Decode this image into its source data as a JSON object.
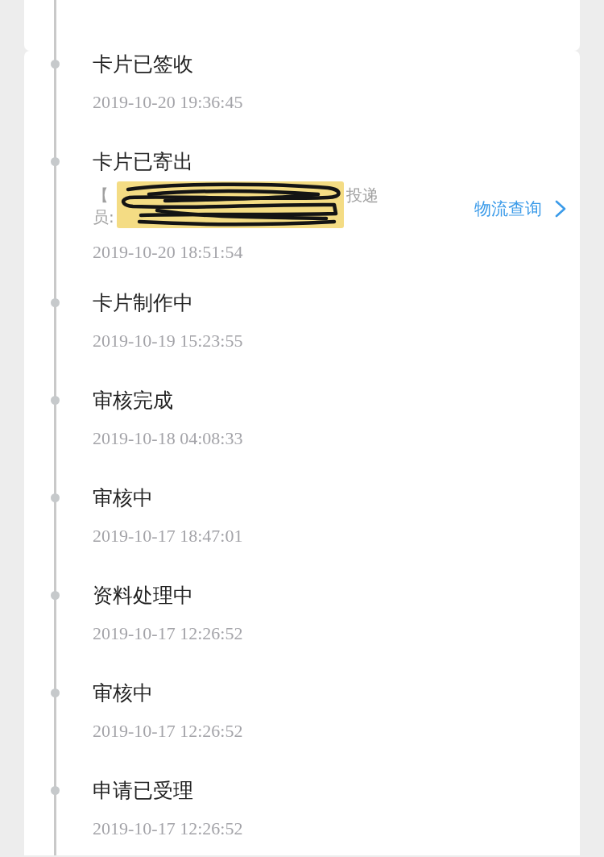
{
  "timeline": [
    {
      "title": "卡片已签收",
      "time": "2019-10-20 19:36:45"
    },
    {
      "title": "卡片已寄出",
      "detail": {
        "redacted": true,
        "lines": [
          {
            "fragments": [
              "【",
              "投递"
            ]
          },
          {
            "fragments": [
              "员:"
            ]
          }
        ]
      },
      "action": {
        "label": "物流查询"
      },
      "time": "2019-10-20 18:51:54"
    },
    {
      "title": "卡片制作中",
      "time": "2019-10-19 15:23:55"
    },
    {
      "title": "审核完成",
      "time": "2019-10-18 04:08:33"
    },
    {
      "title": "审核中",
      "time": "2019-10-17 18:47:01"
    },
    {
      "title": "资料处理中",
      "time": "2019-10-17 12:26:52"
    },
    {
      "title": "审核中",
      "time": "2019-10-17 12:26:52"
    },
    {
      "title": "申请已受理",
      "time": "2019-10-17 12:26:52"
    }
  ]
}
